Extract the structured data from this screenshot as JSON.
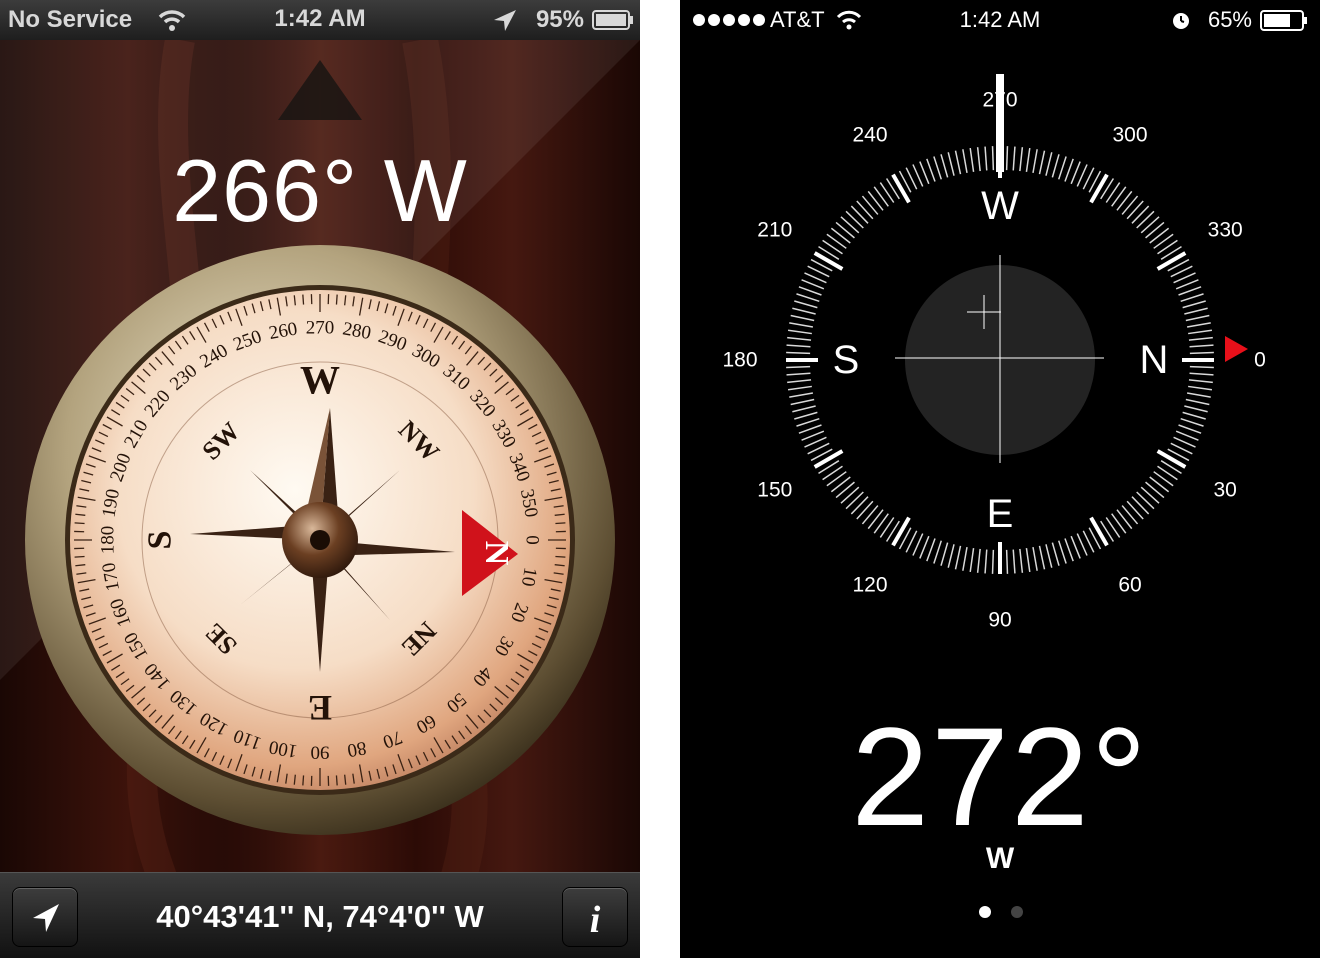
{
  "left": {
    "status": {
      "carrier": "No Service",
      "time": "1:42 AM",
      "battery": "95%"
    },
    "heading": "266° W",
    "coordinates": "40°43'41'' N, 74°4'0'' W",
    "dial": {
      "cardinals": [
        "N",
        "E",
        "S",
        "W"
      ],
      "intercardinals": [
        "NE",
        "SE",
        "SW",
        "NW"
      ],
      "degree_labels": [
        "0",
        "10",
        "20",
        "30",
        "40",
        "50",
        "60",
        "70",
        "80",
        "90",
        "100",
        "110",
        "120",
        "130",
        "140",
        "150",
        "160",
        "170",
        "180",
        "190",
        "200",
        "210",
        "220",
        "230",
        "240",
        "250",
        "260",
        "270",
        "280",
        "290",
        "300",
        "310",
        "320",
        "330",
        "340",
        "350"
      ]
    },
    "icons": {
      "location": "location-arrow-icon",
      "info": "info-icon",
      "wifi": "wifi-icon",
      "battery": "battery-icon"
    }
  },
  "right": {
    "status": {
      "carrier": "AT&T",
      "time": "1:42 AM",
      "battery": "65%"
    },
    "dial": {
      "cardinals": [
        "N",
        "E",
        "S",
        "W"
      ],
      "degree_labels": [
        "0",
        "30",
        "60",
        "90",
        "120",
        "150",
        "180",
        "210",
        "240",
        "270",
        "300",
        "330"
      ]
    },
    "heading_degrees": "272°",
    "heading_direction": "W",
    "page_count": 2,
    "active_page": 1,
    "accent": "#e8101a"
  }
}
